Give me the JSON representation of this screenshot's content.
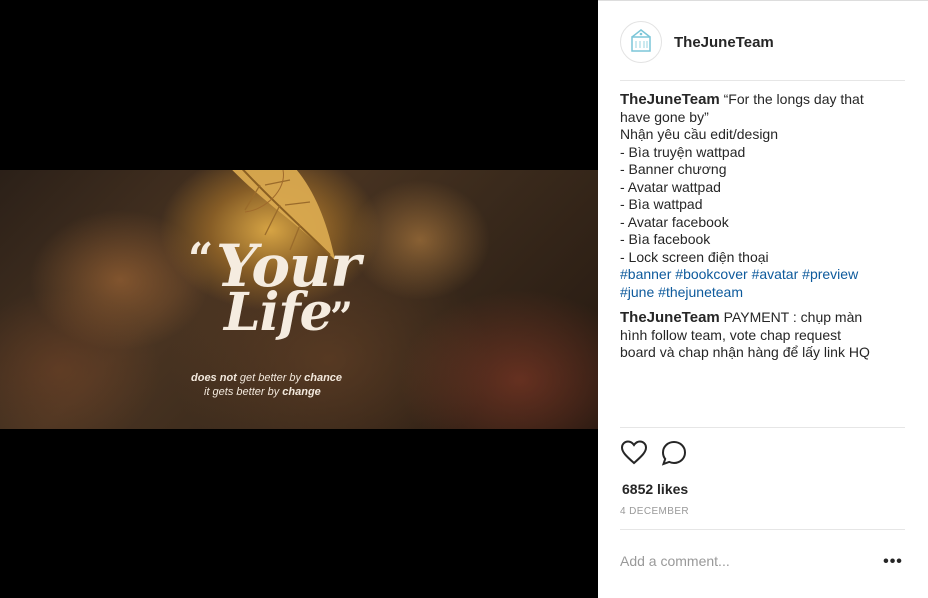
{
  "post": {
    "quote": {
      "open_mark": "“",
      "line1": "Your",
      "line2": "Life",
      "close_mark": "”",
      "sub_line1_part1": "does not",
      "sub_line1_part2": " get better by ",
      "sub_line1_part3": "chance",
      "sub_line2_part1": "it gets better by ",
      "sub_line2_part2": "change"
    }
  },
  "header": {
    "username": "TheJuneTeam"
  },
  "caption": {
    "username": "TheJuneTeam",
    "first_line": " “For the longs day that",
    "lines": [
      "have gone by”",
      "Nhận yêu cầu edit/design",
      "- Bìa truyện wattpad",
      "- Banner chương",
      "- Avatar wattpad",
      "- Bìa wattpad",
      "- Avatar facebook",
      "- Bìa facebook",
      "- Lock screen điện thoại"
    ],
    "hashtags_line1": [
      "#banner",
      "#bookcover",
      "#avatar",
      "#preview"
    ],
    "hashtags_line2": [
      "#june",
      "#thejuneteam"
    ]
  },
  "comment": {
    "username": "TheJuneTeam",
    "first_line": " PAYMENT : chụp màn",
    "lines": [
      "hình follow team, vote chap request",
      "board và chap nhận hàng để lấy link HQ"
    ]
  },
  "stats": {
    "likes": "6852 likes",
    "date": "4 DECEMBER"
  },
  "comment_box": {
    "placeholder": "Add a comment..."
  },
  "more_label": "•••",
  "colors": {
    "hashtag": "#0d5a9c",
    "text": "#262626",
    "muted": "#999999"
  }
}
